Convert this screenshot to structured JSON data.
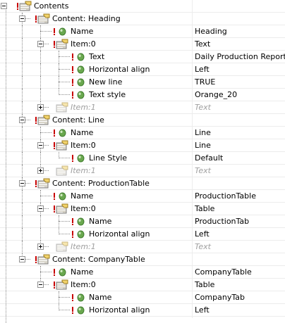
{
  "tree": {
    "rows": [
      {
        "level": 0,
        "kind": "folder",
        "toggle": "minus",
        "label": "Contents",
        "value": ""
      },
      {
        "level": 1,
        "kind": "folder",
        "toggle": "minus",
        "label": "Content: Heading",
        "value": ""
      },
      {
        "level": 2,
        "kind": "leaf",
        "toggle": "",
        "label": "Name",
        "value": "Heading"
      },
      {
        "level": 2,
        "kind": "folder",
        "toggle": "minus",
        "label": "Item:0",
        "value": "Text"
      },
      {
        "level": 3,
        "kind": "leaf",
        "toggle": "",
        "label": "Text",
        "value": "Daily Production Report"
      },
      {
        "level": 3,
        "kind": "leaf",
        "toggle": "",
        "label": "Horizontal align",
        "value": "Left"
      },
      {
        "level": 3,
        "kind": "leaf",
        "toggle": "",
        "label": "New line",
        "value": "TRUE"
      },
      {
        "level": 3,
        "kind": "leaf",
        "toggle": "",
        "label": "Text style",
        "value": "Orange_20"
      },
      {
        "level": 2,
        "kind": "folder",
        "toggle": "plus",
        "ghost": true,
        "label": "Item:1",
        "value": "Text"
      },
      {
        "level": 1,
        "kind": "folder",
        "toggle": "minus",
        "label": "Content: Line",
        "value": ""
      },
      {
        "level": 2,
        "kind": "leaf",
        "toggle": "",
        "label": "Name",
        "value": "Line"
      },
      {
        "level": 2,
        "kind": "folder",
        "toggle": "minus",
        "label": "Item:0",
        "value": "Line"
      },
      {
        "level": 3,
        "kind": "leaf",
        "toggle": "",
        "label": "Line Style",
        "value": "Default"
      },
      {
        "level": 2,
        "kind": "folder",
        "toggle": "plus",
        "ghost": true,
        "label": "Item:1",
        "value": "Text"
      },
      {
        "level": 1,
        "kind": "folder",
        "toggle": "minus",
        "label": "Content: ProductionTable",
        "value": ""
      },
      {
        "level": 2,
        "kind": "leaf",
        "toggle": "",
        "label": "Name",
        "value": "ProductionTable"
      },
      {
        "level": 2,
        "kind": "folder",
        "toggle": "minus",
        "label": "Item:0",
        "value": "Table"
      },
      {
        "level": 3,
        "kind": "leaf",
        "toggle": "",
        "label": "Name",
        "value": "ProductionTab"
      },
      {
        "level": 3,
        "kind": "leaf",
        "toggle": "",
        "label": "Horizontal align",
        "value": "Left"
      },
      {
        "level": 2,
        "kind": "folder",
        "toggle": "plus",
        "ghost": true,
        "label": "Item:1",
        "value": "Text"
      },
      {
        "level": 1,
        "kind": "folder",
        "toggle": "minus",
        "label": "Content: CompanyTable",
        "value": ""
      },
      {
        "level": 2,
        "kind": "leaf",
        "toggle": "",
        "label": "Name",
        "value": "CompanyTable"
      },
      {
        "level": 2,
        "kind": "folder",
        "toggle": "minus",
        "label": "Item:0",
        "value": "Table"
      },
      {
        "level": 3,
        "kind": "leaf",
        "toggle": "",
        "label": "Name",
        "value": "CompanyTab"
      },
      {
        "level": 3,
        "kind": "leaf",
        "toggle": "",
        "label": "Horizontal align",
        "value": "Left"
      }
    ]
  },
  "icons": {
    "folder": "property-folder-icon",
    "leaf": "green-property-dot-icon",
    "warning": "required-exclamation-icon"
  },
  "colors": {
    "folder_body": "#d7d3c8",
    "folder_tab": "#f2d36b",
    "leaf_dot": "#6aa84f",
    "warning": "#c80000",
    "ghost_text": "#a0a0a0"
  }
}
